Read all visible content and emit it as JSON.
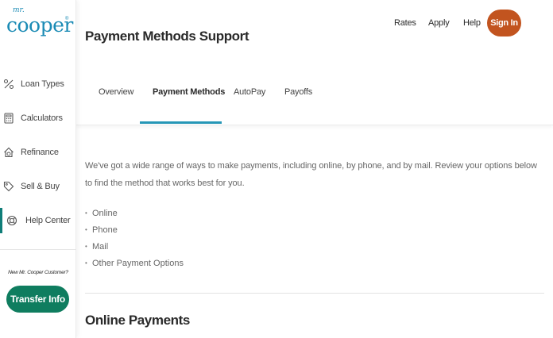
{
  "brand": {
    "logo_mr": "mr.",
    "logo_cooper": "cooper",
    "logo_reg": "®",
    "accent": "#1b8bb5",
    "teal": "#0f7d5f",
    "orange": "#c2541f",
    "tab_underline": "#2596b6"
  },
  "sidebar": {
    "items": [
      {
        "label": "Loan Types",
        "icon": "percent-tag-icon"
      },
      {
        "label": "Calculators",
        "icon": "calculator-icon"
      },
      {
        "label": "Refinance",
        "icon": "house-dollar-icon"
      },
      {
        "label": "Sell & Buy",
        "icon": "price-tag-icon"
      },
      {
        "label": "Help Center",
        "icon": "lifebuoy-icon",
        "active": true
      }
    ],
    "new_customer_text": "New Mr. Cooper Customer?",
    "transfer_button": "Transfer Info"
  },
  "header": {
    "title": "Payment Methods Support",
    "links": [
      "Rates",
      "Apply",
      "Help"
    ],
    "sign_in": "Sign In"
  },
  "tabs": [
    {
      "label": "Overview"
    },
    {
      "label": "Payment Methods",
      "active": true
    },
    {
      "label": "AutoPay"
    },
    {
      "label": "Payoffs"
    }
  ],
  "content": {
    "intro": "We've got a wide range of ways to make payments, including online, by phone, and by mail. Review your options below to find the method that works best for you.",
    "options": [
      "Online",
      "Phone",
      "Mail",
      "Other Payment Options"
    ],
    "section_heading": "Online Payments"
  }
}
